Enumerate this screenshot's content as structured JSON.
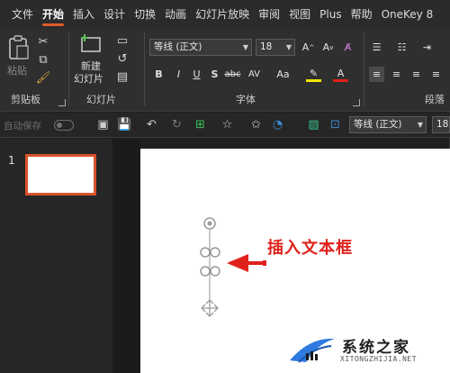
{
  "menu": {
    "tabs": [
      "文件",
      "开始",
      "插入",
      "设计",
      "切换",
      "动画",
      "幻灯片放映",
      "审阅",
      "视图",
      "Plus",
      "帮助",
      "OneKey 8"
    ],
    "active_tab": "开始"
  },
  "ribbon": {
    "clipboard": {
      "paste_label": "粘贴",
      "group_label": "剪贴板"
    },
    "slides": {
      "new_slide_label_line1": "新建",
      "new_slide_label_line2": "幻灯片",
      "group_label": "幻灯片"
    },
    "font": {
      "font_name": "等线 (正文)",
      "font_size": "18",
      "group_label": "字体"
    },
    "paragraph": {
      "group_label": "段落"
    }
  },
  "qat": {
    "autosave_label": "自动保存",
    "font_name": "等线 (正文)",
    "font_size": "18"
  },
  "slide_pane": {
    "slides": [
      {
        "number": "1"
      }
    ]
  },
  "annotation": {
    "text": "插入文本框",
    "color": "#e0201b"
  },
  "watermark": {
    "title": "系统之家",
    "subtitle": "XITONGZHIJIA.NET"
  },
  "colors": {
    "accent": "#e05a2a",
    "thumb_border": "#d9532b",
    "arrow": "#e0201b"
  }
}
